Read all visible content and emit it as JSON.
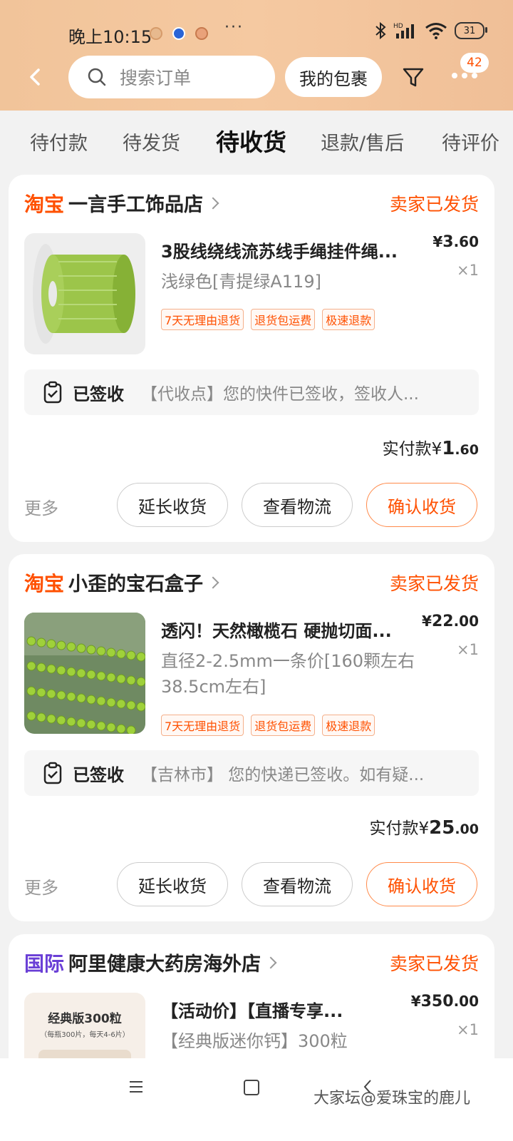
{
  "status_bar": {
    "time": "晚上10:15",
    "more": "···",
    "battery": "31"
  },
  "header": {
    "search_placeholder": "搜索订单",
    "parcel_button": "我的包裹",
    "message_badge": "42"
  },
  "tabs": [
    {
      "label": "待付款"
    },
    {
      "label": "待发货"
    },
    {
      "label": "待收货",
      "active": true
    },
    {
      "label": "退款/售后"
    },
    {
      "label": "待评价"
    }
  ],
  "orders": [
    {
      "platform": "淘宝",
      "shop": "一言手工饰品店",
      "status": "卖家已发货",
      "title": "3股线绕线流苏线手绳挂件绳...",
      "spec": "浅绿色[青提绿A119]",
      "price_symbol": "¥",
      "price_int": "3",
      "price_dec": ".60",
      "qty": "×1",
      "tags": [
        "7天无理由退货",
        "退货包运费",
        "极速退款"
      ],
      "logistics_status": "已签收",
      "logistics_text": "【代收点】您的快件已签收，签收人...",
      "paid_label": "实付款",
      "paid_symbol": "¥",
      "paid_int": "1",
      "paid_dec": ".60",
      "more": "更多",
      "btn_extend": "延长收货",
      "btn_track": "查看物流",
      "btn_confirm": "确认收货"
    },
    {
      "platform": "淘宝",
      "shop": "小歪的宝石盒子",
      "status": "卖家已发货",
      "title": "透闪！天然橄榄石 硬抛切面...",
      "spec": "直径2-2.5mm一条价[160颗左右 38.5cm左右]",
      "price_symbol": "¥",
      "price_int": "22",
      "price_dec": ".00",
      "qty": "×1",
      "tags": [
        "7天无理由退货",
        "退货包运费",
        "极速退款"
      ],
      "logistics_status": "已签收",
      "logistics_text": "【吉林市】 您的快递已签收。如有疑...",
      "paid_label": "实付款",
      "paid_symbol": "¥",
      "paid_int": "25",
      "paid_dec": ".00",
      "more": "更多",
      "btn_extend": "延长收货",
      "btn_track": "查看物流",
      "btn_confirm": "确认收货"
    },
    {
      "platform": "国际",
      "shop": "阿里健康大药房海外店",
      "status": "卖家已发货",
      "title": "【活动价】【直播专享...",
      "spec": "【经典版迷你钙】300粒",
      "price_symbol": "¥",
      "price_int": "350",
      "price_dec": ".00",
      "qty": "×1",
      "thumb_text": "经典版300粒",
      "thumb_sub": "（每瓶300片，每天4-6片）"
    }
  ],
  "watermark": "大家坛@爱珠宝的鹿儿"
}
